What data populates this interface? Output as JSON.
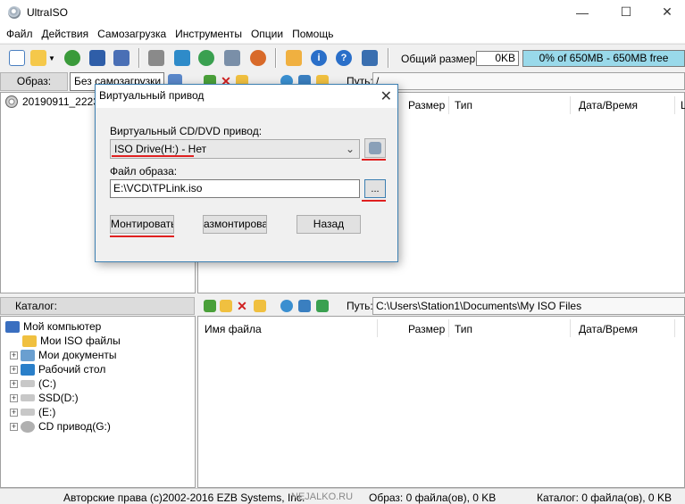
{
  "window": {
    "title": "UltraISO"
  },
  "menu": [
    "Файл",
    "Действия",
    "Самозагрузка",
    "Инструменты",
    "Опции",
    "Помощь"
  ],
  "toolbar": {
    "size_label": "Общий размер:",
    "size_value": "0KB",
    "capacity_text": "0% of 650MB - 650MB free"
  },
  "image_panel": {
    "label": "Образ:",
    "boot_value": "Без самозагрузки",
    "tree_item": "20190911_2223",
    "path_label": "Путь:",
    "path_value": "/"
  },
  "upper_columns": {
    "size": "Размер",
    "type": "Тип",
    "date": "Дата/Время",
    "extra": "L"
  },
  "catalog": {
    "label": "Каталог:",
    "path_label": "Путь:",
    "path_value": "C:\\Users\\Station1\\Documents\\My ISO Files",
    "tree": [
      "Мой компьютер",
      "Мои ISO файлы",
      "Мои документы",
      "Рабочий стол",
      "(C:)",
      "SSD(D:)",
      "(E:)",
      "CD привод(G:)"
    ]
  },
  "lower_columns": {
    "name": "Имя файла",
    "size": "Размер",
    "type": "Тип",
    "date": "Дата/Время"
  },
  "dialog": {
    "title": "Виртуальный привод",
    "drive_label": "Виртуальный CD/DVD привод:",
    "drive_value": "ISO Drive(H:) - Нет",
    "file_label": "Файл образа:",
    "file_value": "E:\\VCD\\TPLink.iso",
    "browse_label": "...",
    "mount_label": "Монтировать",
    "unmount_label": "азмонтирова",
    "back_label": "Назад"
  },
  "status": {
    "copyright": "Авторские права (c)2002-2016 EZB Systems, Inc.",
    "watermark": "NEJALKO.RU",
    "image_info": "Образ: 0 файла(ов), 0 KB",
    "catalog_info": "Каталог: 0 файла(ов), 0 KB"
  },
  "colors": {
    "capacity_bar": "#99d9ea",
    "accent_underline": "#e02020",
    "dialog_border": "#3c7fb1"
  },
  "icons": [
    "app-disc-icon",
    "new-icon",
    "open-icon",
    "save-icon",
    "properties-icon",
    "info-icon",
    "help-icon",
    "exit-icon"
  ]
}
